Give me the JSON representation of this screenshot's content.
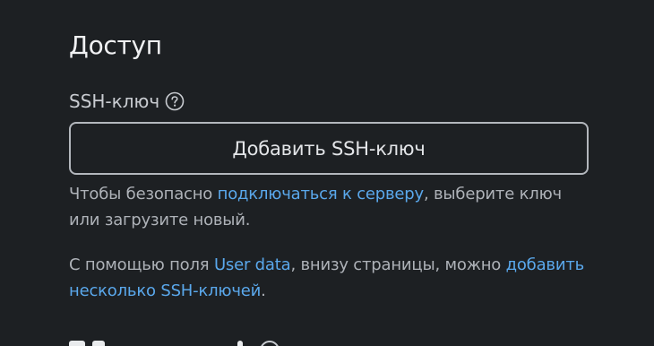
{
  "access": {
    "title": "Доступ",
    "ssh_field": {
      "label": "SSH-ключ",
      "help_icon": "question-circle-icon",
      "add_button_label": "Добавить SSH-ключ"
    },
    "hint_connect": {
      "before": "Чтобы безопасно ",
      "link": "подключаться к серверу",
      "after": ", выберите ключ или загрузите новый."
    },
    "hint_user_data": {
      "before": "С помощью поля ",
      "link_1": "User data",
      "middle": ", внизу страницы, можно ",
      "link_2": "добавить несколько SSH-ключей",
      "after": "."
    }
  },
  "colors": {
    "background": "#1d2023",
    "link": "#5aa8ec",
    "button_border": "#b3b7bd"
  }
}
